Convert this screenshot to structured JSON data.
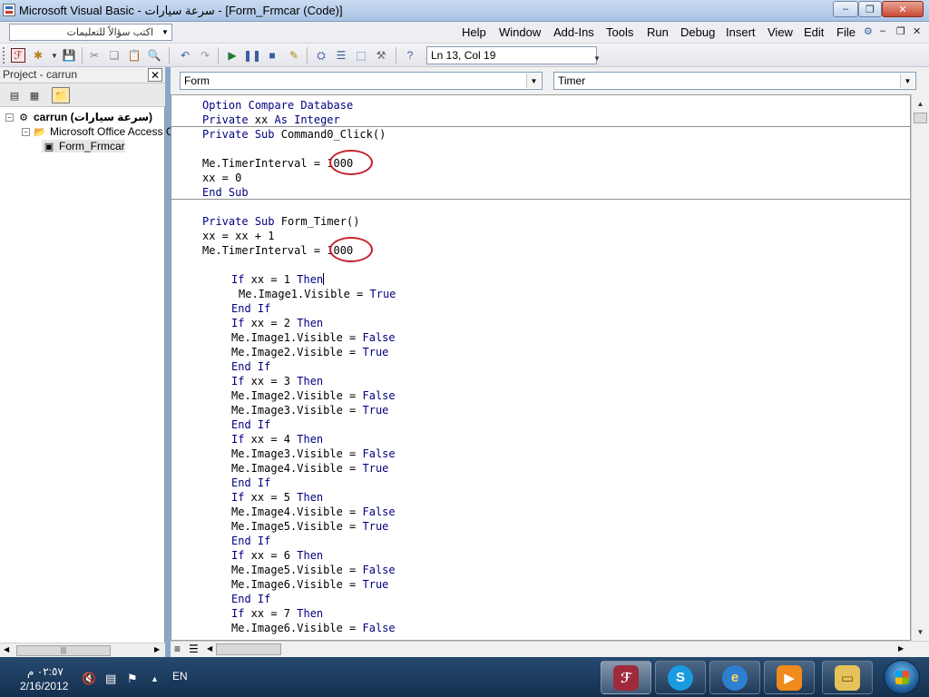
{
  "window": {
    "title": "Microsoft Visual Basic - سرعة سيارات - [Form_Frmcar (Code)]",
    "caption_buttons": {
      "minimize": "–",
      "restore": "❐",
      "close": "✕"
    }
  },
  "menubar": {
    "question_box": "اكتب سؤالاً للتعليمات",
    "items": [
      "Help",
      "Window",
      "Add-Ins",
      "Tools",
      "Run",
      "Debug",
      "Insert",
      "View",
      "Edit",
      "File"
    ],
    "mdi_buttons": [
      "–",
      "❐",
      "✕"
    ]
  },
  "toolbar": {
    "position_text": "Ln 13, Col 19"
  },
  "project": {
    "header": "Project - carrun",
    "close_glyph": "✕",
    "tree": {
      "root": "carrun (سرعة سيارات)",
      "folder": "Microsoft Office Access C",
      "form": "Form_Frmcar"
    }
  },
  "code": {
    "object_combo": "Form",
    "procedure_combo": "Timer",
    "lines": [
      {
        "text": "Option Compare Database",
        "kw": true
      },
      {
        "text": "Private xx As Integer",
        "kw": true
      },
      {
        "text": "Private Sub Command0_Click()",
        "kw": true
      },
      {
        "text": ""
      },
      {
        "text": "Me.TimerInterval = 1000"
      },
      {
        "text": "xx = 0"
      },
      {
        "text": "End Sub",
        "kw": true
      },
      {
        "text": ""
      },
      {
        "text": "Private Sub Form_Timer()",
        "kw": true
      },
      {
        "text": "xx = xx + 1"
      },
      {
        "text": "Me.TimerInterval = 1000"
      },
      {
        "text": ""
      },
      {
        "text": "If xx = 1 Then",
        "indent": 1
      },
      {
        "text": "Me.Image1.Visible = True",
        "indent": 2
      },
      {
        "text": "End If",
        "indent": 1
      },
      {
        "text": "If xx = 2 Then",
        "indent": 1
      },
      {
        "text": "Me.Image1.Visible = False",
        "indent": 1
      },
      {
        "text": "Me.Image2.Visible = True",
        "indent": 1
      },
      {
        "text": "End If",
        "indent": 1
      },
      {
        "text": "If xx = 3 Then",
        "indent": 1
      },
      {
        "text": "Me.Image2.Visible = False",
        "indent": 1
      },
      {
        "text": "Me.Image3.Visible = True",
        "indent": 1
      },
      {
        "text": "End If",
        "indent": 1
      },
      {
        "text": "If xx = 4 Then",
        "indent": 1
      },
      {
        "text": "Me.Image3.Visible = False",
        "indent": 1
      },
      {
        "text": "Me.Image4.Visible = True",
        "indent": 1
      },
      {
        "text": "End If",
        "indent": 1
      },
      {
        "text": "If xx = 5 Then",
        "indent": 1
      },
      {
        "text": "Me.Image4.Visible = False",
        "indent": 1
      },
      {
        "text": "Me.Image5.Visible = True",
        "indent": 1
      },
      {
        "text": "End If",
        "indent": 1
      },
      {
        "text": "If xx = 6 Then",
        "indent": 1
      },
      {
        "text": "Me.Image5.Visible = False",
        "indent": 1
      },
      {
        "text": "Me.Image6.Visible = True",
        "indent": 1
      },
      {
        "text": "End If",
        "indent": 1
      },
      {
        "text": "If xx = 7 Then",
        "indent": 1
      },
      {
        "text": "Me.Image6.Visible = False",
        "indent": 1
      }
    ],
    "keyword_color": "#00007f",
    "annotation_color": "#c8232c"
  },
  "taskbar": {
    "time": "٠٢:٥٧ م",
    "date": "2/16/2012",
    "language": "EN",
    "apps": [
      "access-icon",
      "skype-icon",
      "internet-explorer-icon",
      "media-player-icon",
      "windows-explorer-icon"
    ]
  }
}
